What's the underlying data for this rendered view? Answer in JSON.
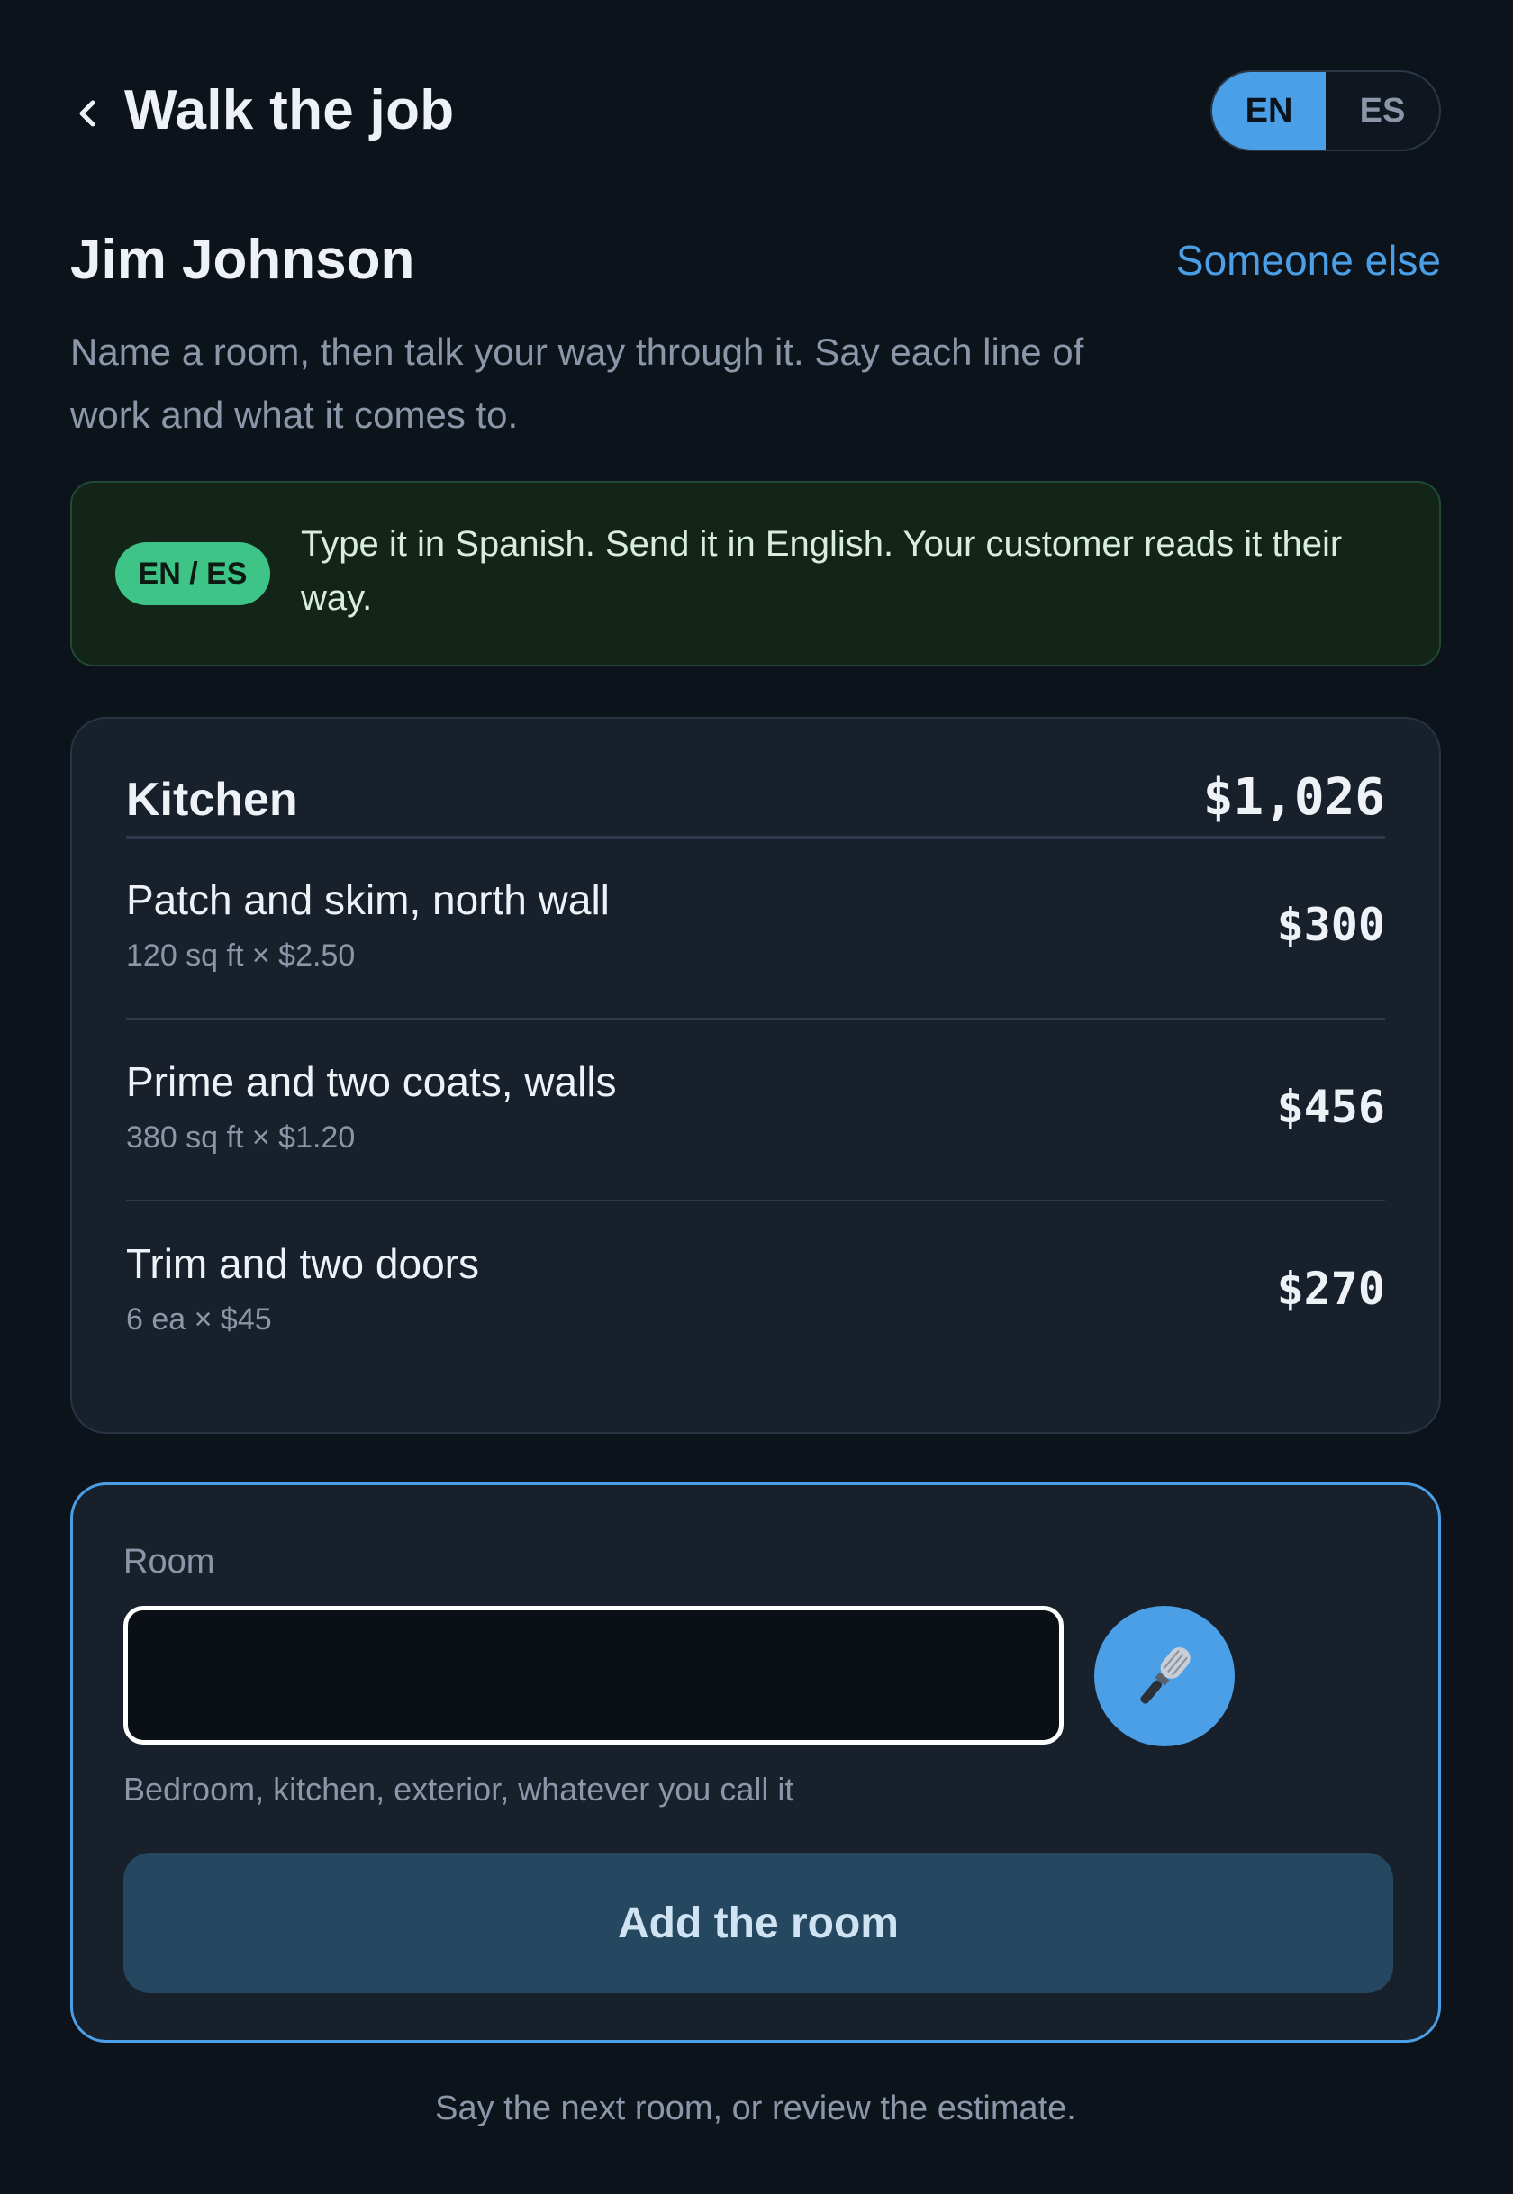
{
  "header": {
    "back_icon": "chevron-left-icon",
    "title": "Walk the job",
    "languages": [
      {
        "code": "EN",
        "active": true
      },
      {
        "code": "ES",
        "active": false
      }
    ]
  },
  "customer": {
    "name": "Jim Johnson",
    "switch_label": "Someone else",
    "intro": "Name a room, then talk your way through it. Say each line of work and what it comes to."
  },
  "banner": {
    "badge": "EN / ES",
    "text": "Type it in Spanish. Send it in English. Your customer reads it their way."
  },
  "room": {
    "name": "Kitchen",
    "total": "$1,026",
    "items": [
      {
        "name": "Patch and skim, north wall",
        "detail": "120 sq ft × $2.50",
        "amount": "$300"
      },
      {
        "name": "Prime and two coats, walls",
        "detail": "380 sq ft × $1.20",
        "amount": "$456"
      },
      {
        "name": "Trim and two doors",
        "detail": "6 ea × $45",
        "amount": "$270"
      }
    ]
  },
  "add_room": {
    "label": "Room",
    "value": "",
    "mic_icon": "microphone-icon",
    "hint": "Bedroom, kitchen, exterior, whatever you call it",
    "button_label": "Add the room"
  },
  "footer": {
    "hint": "Say the next room, or review the estimate."
  },
  "colors": {
    "background": "#0d131b",
    "accent": "#4a9fe6",
    "success": "#3ec486",
    "card": "#17202b",
    "muted_text": "#8b96a8"
  }
}
